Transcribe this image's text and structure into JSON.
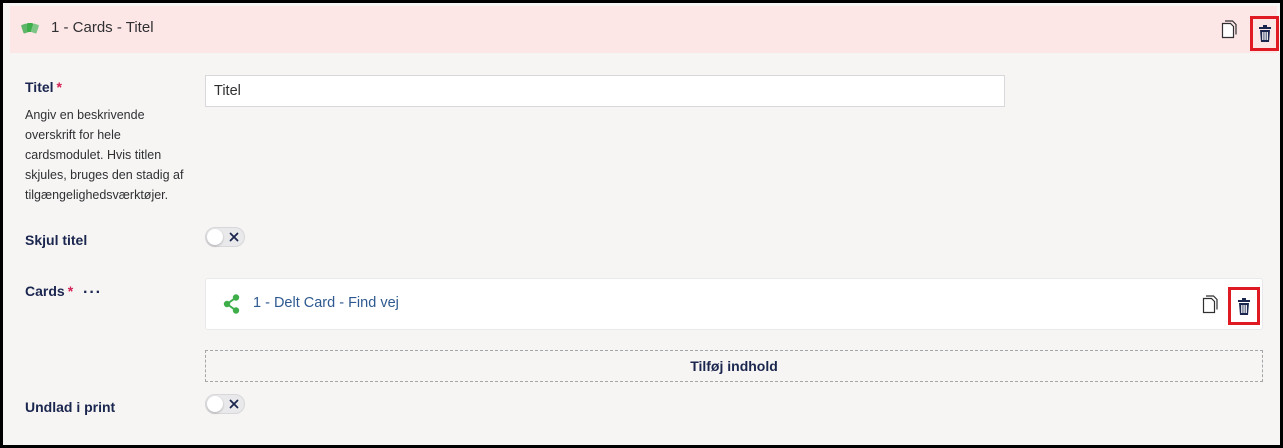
{
  "header": {
    "title": "1 - Cards - Titel",
    "icon": "cards-icon",
    "accent_color": "#fde6e6",
    "highlight_color": "#e01a22"
  },
  "fields": {
    "title": {
      "label": "Titel",
      "required_mark": "*",
      "description": "Angiv en beskrivende overskrift for hele cardsmodulet. Hvis titlen skjules, bruges den stadig af tilgængelighedsværktøjer.",
      "value": "Titel"
    },
    "hide_title": {
      "label": "Skjul titel",
      "checked": false
    },
    "cards": {
      "label": "Cards",
      "required_mark": "*",
      "more": "···",
      "items": [
        {
          "name": "1 - Delt Card - Find vej",
          "icon": "share-icon",
          "icon_color": "#3eae4a"
        }
      ],
      "add_label": "Tilføj indhold"
    },
    "exclude_print": {
      "label": "Undlad i print",
      "checked": false
    }
  }
}
